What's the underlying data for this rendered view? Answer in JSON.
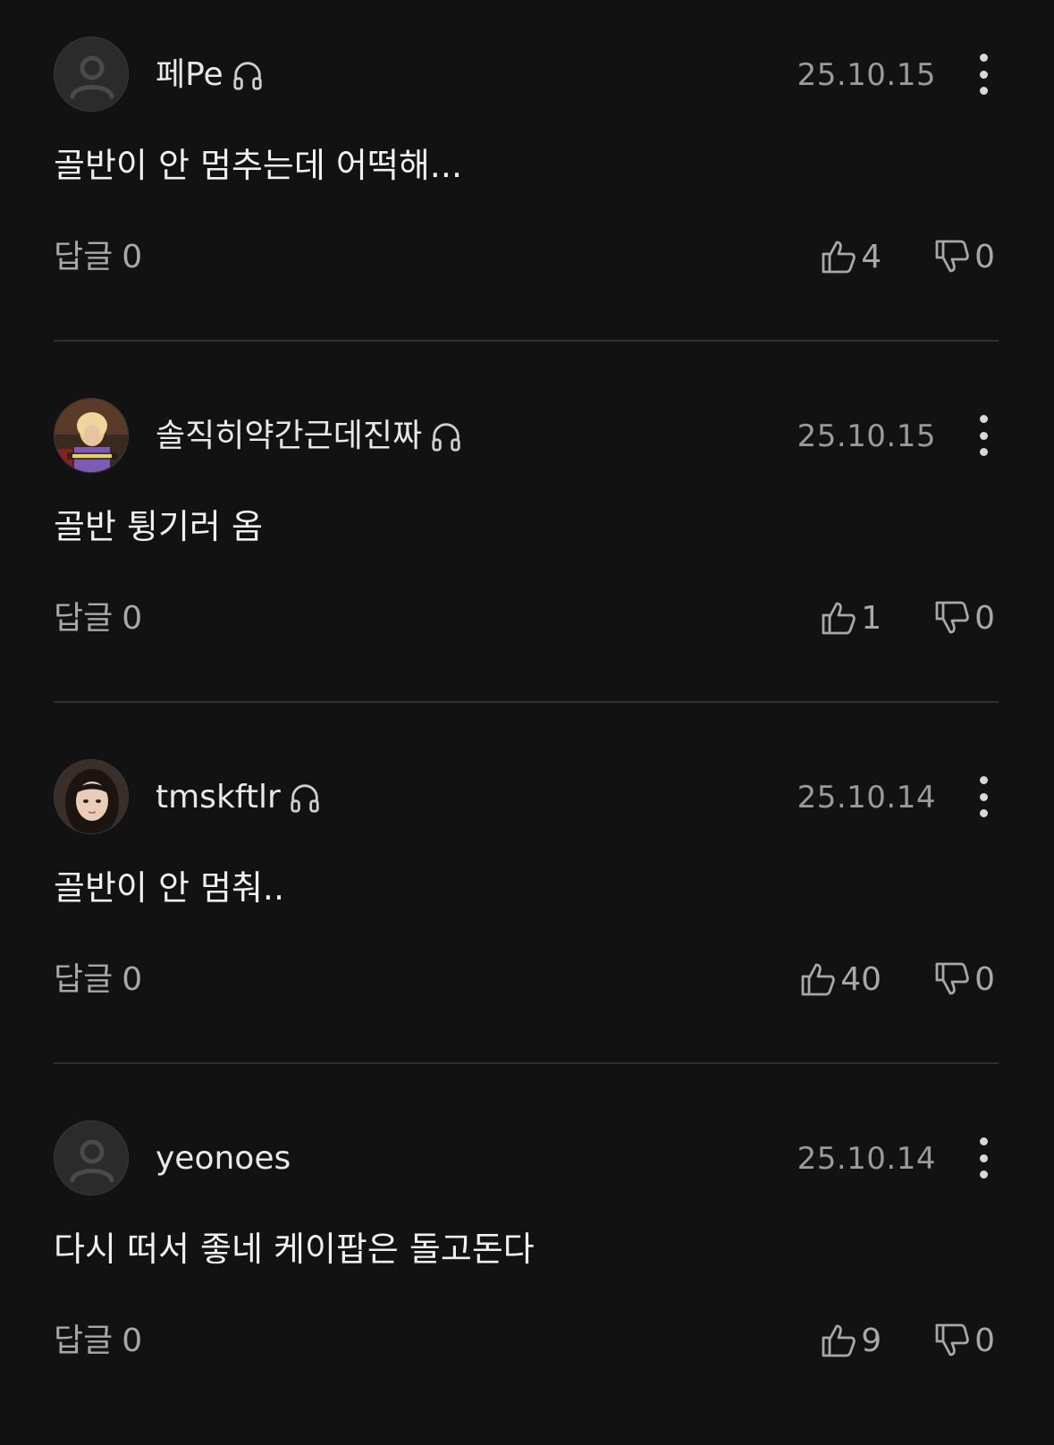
{
  "comments": [
    {
      "username": "페Pe",
      "has_headphone": true,
      "avatar": "default-avatar-icon",
      "date": "25.10.15",
      "text": "골반이 안 멈추는데 어떡해...",
      "reply_label": "답글",
      "reply_count": "0",
      "likes": "4",
      "dislikes": "0"
    },
    {
      "username": "솔직히약간근데진짜",
      "has_headphone": true,
      "avatar": "photo-avatar",
      "date": "25.10.15",
      "text": "골반 튕기러 옴",
      "reply_label": "답글",
      "reply_count": "0",
      "likes": "1",
      "dislikes": "0"
    },
    {
      "username": "tmskftlr",
      "has_headphone": true,
      "avatar": "photo-avatar",
      "date": "25.10.14",
      "text": "골반이 안 멈춰..",
      "reply_label": "답글",
      "reply_count": "0",
      "likes": "40",
      "dislikes": "0"
    },
    {
      "username": "yeonoes",
      "has_headphone": false,
      "avatar": "default-avatar-icon",
      "date": "25.10.14",
      "text": "다시 떠서 좋네 케이팝은 돌고돈다",
      "reply_label": "답글",
      "reply_count": "0",
      "likes": "9",
      "dislikes": "0"
    }
  ],
  "colors": {
    "background": "#121212",
    "text_primary": "#f0f0f0",
    "text_secondary": "#a8a8a8",
    "divider": "#2f2f2f"
  }
}
